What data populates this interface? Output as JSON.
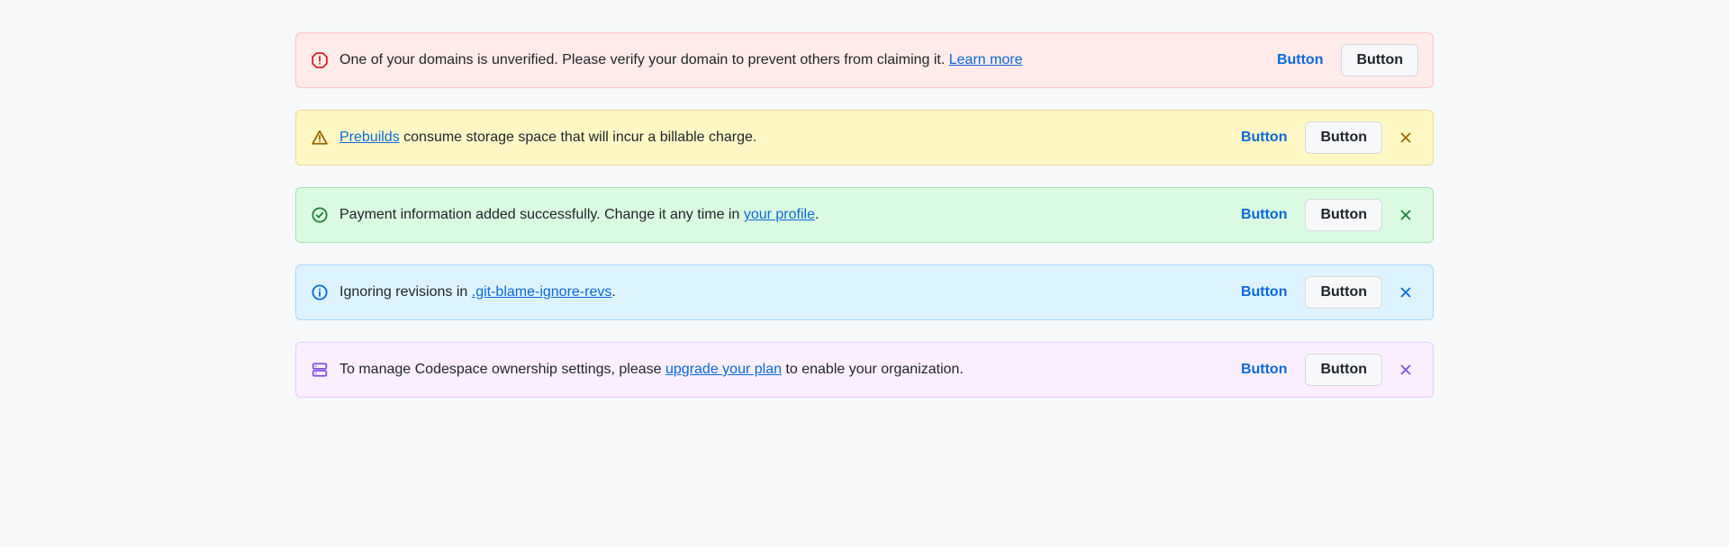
{
  "banners": [
    {
      "variant": "critical",
      "icon": "stop-icon",
      "text_before": "One of your domains is unverified. Please verify your domain to prevent others from claiming it. ",
      "link_text": "Learn more",
      "text_after": "",
      "primary_button": "Button",
      "secondary_button": "Button",
      "dismissible": false
    },
    {
      "variant": "warning",
      "icon": "alert-icon",
      "text_before": "",
      "link_text": "Prebuilds",
      "text_after": " consume storage space that will incur a billable charge.",
      "primary_button": "Button",
      "secondary_button": "Button",
      "dismissible": true
    },
    {
      "variant": "success",
      "icon": "check-circle-icon",
      "text_before": "Payment information added successfully. Change it any time in ",
      "link_text": "your profile",
      "text_after": ".",
      "primary_button": "Button",
      "secondary_button": "Button",
      "dismissible": true
    },
    {
      "variant": "info",
      "icon": "info-icon",
      "text_before": "Ignoring revisions in ",
      "link_text": ".git-blame-ignore-revs",
      "text_after": ".",
      "primary_button": "Button",
      "secondary_button": "Button",
      "dismissible": true
    },
    {
      "variant": "upsell",
      "icon": "server-icon",
      "text_before": "To manage Codespace ownership settings, please ",
      "link_text": "upgrade your plan",
      "text_after": " to enable your organization.",
      "primary_button": "Button",
      "secondary_button": "Button",
      "dismissible": true
    }
  ]
}
